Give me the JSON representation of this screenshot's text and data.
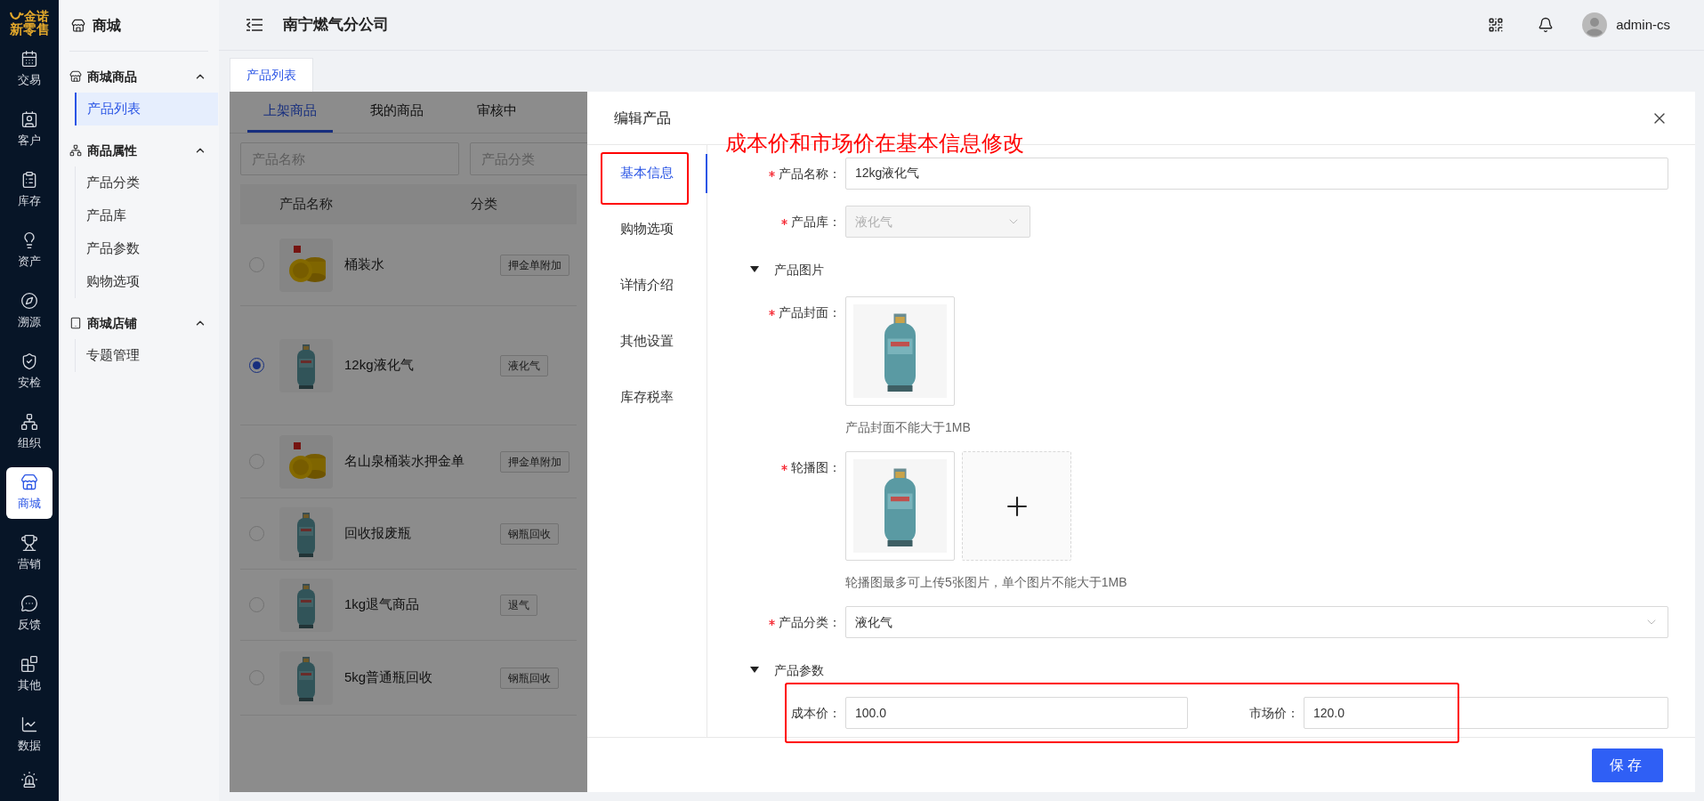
{
  "logo": {
    "name": "金诺",
    "tagline": "新零售"
  },
  "rail": [
    {
      "label": "交易",
      "selected": false
    },
    {
      "label": "客户",
      "selected": false
    },
    {
      "label": "库存",
      "selected": false
    },
    {
      "label": "资产",
      "selected": false
    },
    {
      "label": "溯源",
      "selected": false
    },
    {
      "label": "安检",
      "selected": false
    },
    {
      "label": "组织",
      "selected": false
    },
    {
      "label": "商城",
      "selected": true
    },
    {
      "label": "营销",
      "selected": false
    },
    {
      "label": "反馈",
      "selected": false
    },
    {
      "label": "其他",
      "selected": false
    },
    {
      "label": "数据",
      "selected": false
    }
  ],
  "sidebar": {
    "title": "商城",
    "groups": [
      {
        "title": "商城商品",
        "expanded": true,
        "items": [
          {
            "label": "产品列表",
            "selected": true
          }
        ]
      },
      {
        "title": "商品属性",
        "expanded": true,
        "items": [
          {
            "label": "产品分类",
            "selected": false
          },
          {
            "label": "产品库",
            "selected": false
          },
          {
            "label": "产品参数",
            "selected": false
          },
          {
            "label": "购物选项",
            "selected": false
          }
        ]
      },
      {
        "title": "商城店铺",
        "expanded": true,
        "items": [
          {
            "label": "专题管理",
            "selected": false
          }
        ]
      }
    ]
  },
  "header": {
    "title": "南宁燃气分公司",
    "user": "admin-cs"
  },
  "page_tabs": [
    {
      "label": "产品列表",
      "selected": true
    }
  ],
  "list": {
    "tabs": [
      {
        "label": "上架商品",
        "selected": true
      },
      {
        "label": "我的商品",
        "selected": false
      },
      {
        "label": "审核中",
        "selected": false
      }
    ],
    "filters": [
      {
        "placeholder": "产品名称"
      },
      {
        "placeholder": "产品分类"
      }
    ],
    "columns": [
      "产品名称",
      "分类"
    ],
    "rows": [
      {
        "name": "桶装水",
        "category": "押金单附加",
        "selected": false
      },
      {
        "name": "12kg液化气",
        "category": "液化气",
        "selected": true
      },
      {
        "name": "名山泉桶装水押金单",
        "category": "押金单附加",
        "selected": false
      },
      {
        "name": "回收报废瓶",
        "category": "钢瓶回收",
        "selected": false
      },
      {
        "name": "1kg退气商品",
        "category": "退气",
        "selected": false
      },
      {
        "name": "5kg普通瓶回收",
        "category": "钢瓶回收",
        "selected": false
      }
    ]
  },
  "drawer": {
    "title": "编辑产品",
    "annotation": "成本价和市场价在基本信息修改",
    "nav": [
      {
        "label": "基本信息",
        "selected": true,
        "highlighted": true
      },
      {
        "label": "购物选项",
        "selected": false,
        "highlighted": false
      },
      {
        "label": "详情介绍",
        "selected": false,
        "highlighted": false
      },
      {
        "label": "其他设置",
        "selected": false,
        "highlighted": false
      },
      {
        "label": "库存税率",
        "selected": false,
        "highlighted": false
      }
    ],
    "fields": [
      {
        "kind": "text",
        "label": "产品名称：",
        "required": true,
        "value": "12kg液化气"
      },
      {
        "kind": "select",
        "label": "产品库：",
        "required": true,
        "value": "液化气",
        "disabled": true
      },
      {
        "kind": "section",
        "label": "产品图片",
        "expanded": true
      },
      {
        "kind": "images",
        "label": "产品封面：",
        "required": true,
        "add_tile": false,
        "hint": "产品封面不能大于1MB"
      },
      {
        "kind": "images",
        "label": "轮播图：",
        "required": true,
        "add_tile": true,
        "hint": "轮播图最多可上传5张图片，单个图片不能大于1MB"
      },
      {
        "kind": "select",
        "label": "产品分类：",
        "required": true,
        "value": "液化气",
        "disabled": false
      },
      {
        "kind": "section",
        "label": "产品参数",
        "expanded": true
      },
      {
        "kind": "pair",
        "highlighted": true,
        "fields": [
          {
            "label": "成本价：",
            "value": "100.0"
          },
          {
            "label": "市场价：",
            "value": "120.0"
          }
        ]
      }
    ],
    "save": "保存"
  }
}
